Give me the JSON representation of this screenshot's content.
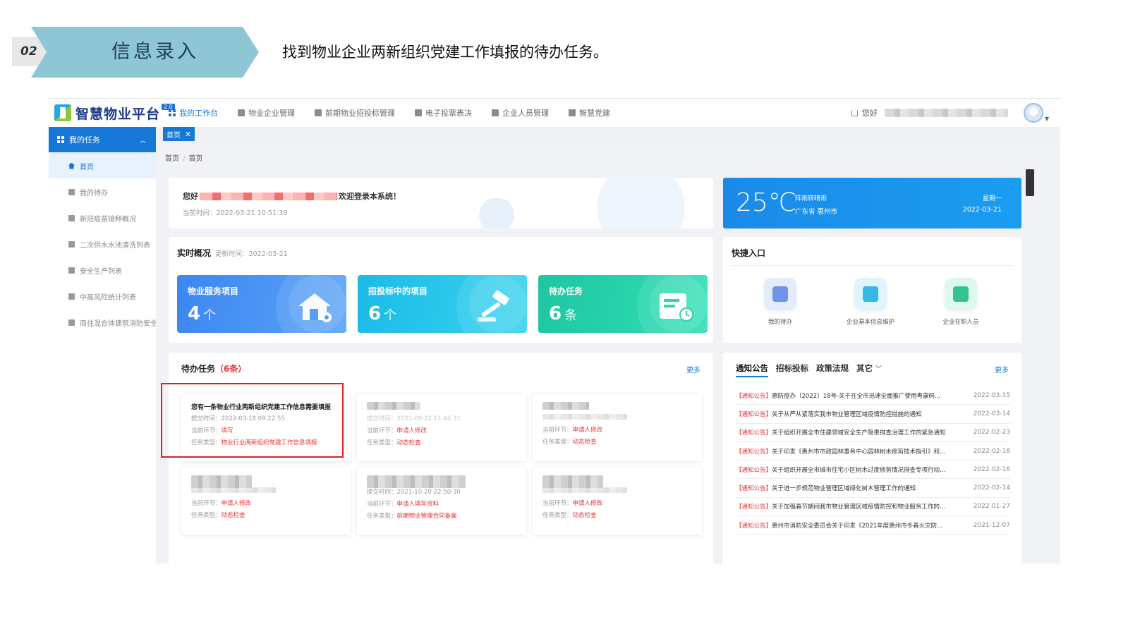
{
  "slide": {
    "step_number": "02",
    "step_title": "信息录入",
    "instruction": "找到物业企业两新组织党建工作填报的待办任务。"
  },
  "colors": {
    "primary": "#1677d8",
    "arrow": "#8fc6d6",
    "highlight": "#e02020",
    "danger": "#e33333"
  },
  "app": {
    "logo_text": "智慧物业平台",
    "logo_version": "2.0",
    "nav": [
      {
        "label": "我的工作台",
        "icon": "grid-icon"
      },
      {
        "label": "物业企业管理",
        "icon": "building-icon"
      },
      {
        "label": "前期物业招投标管理",
        "icon": "document-icon"
      },
      {
        "label": "电子投票表决",
        "icon": "vote-icon"
      },
      {
        "label": "企业人员管理",
        "icon": "person-icon"
      },
      {
        "label": "智慧党建",
        "icon": "flag-icon"
      }
    ],
    "greeting": "您好",
    "sidebar": {
      "group": "我的任务",
      "items": [
        {
          "label": "首页",
          "icon": "home-icon"
        },
        {
          "label": "我的待办",
          "icon": "grid-icon"
        },
        {
          "label": "新冠疫苗接种概况",
          "icon": "edit-icon"
        },
        {
          "label": "二次供水水池清洗列表",
          "icon": "edit-icon"
        },
        {
          "label": "安全生产列表",
          "icon": "briefcase-icon"
        },
        {
          "label": "中高风险统计列表",
          "icon": "table-icon"
        },
        {
          "label": "商住混合体建筑消防安全",
          "icon": "table-icon"
        }
      ]
    },
    "tag": "首页",
    "breadcrumb": [
      "首页",
      "首页"
    ],
    "welcome": {
      "hello": "您好",
      "message": "欢迎登录本系统！",
      "time": "当前时间：2022-03-21 10:51:39"
    },
    "weather": {
      "temp": "25℃",
      "condition": "阵雨转晴雨",
      "city": "广东省 惠州市",
      "weekday": "星期一",
      "date": "2022-03-21"
    },
    "overview": {
      "title": "实时概况",
      "updated": "更新时间：2022-03-21",
      "stats": [
        {
          "label": "物业服务项目",
          "value": "4",
          "unit": "个",
          "icon": "house-icon"
        },
        {
          "label": "招投标中的项目",
          "value": "6",
          "unit": "个",
          "icon": "gavel-icon"
        },
        {
          "label": "待办任务",
          "value": "6",
          "unit": "条",
          "icon": "task-icon"
        }
      ]
    },
    "shortcuts": {
      "title": "快捷入口",
      "items": [
        {
          "label": "我的待办",
          "color": "#e4ecfb",
          "inner": "#6f95e8"
        },
        {
          "label": "企业基本信息维护",
          "color": "#dff4fb",
          "inner": "#37b7e6"
        },
        {
          "label": "企业在职人员",
          "color": "#dff7ee",
          "inner": "#33c38e"
        }
      ]
    },
    "todo": {
      "title": "待办任务",
      "count_open": "（",
      "count": "6条",
      "count_close": "）",
      "more": "更多",
      "tasks": [
        {
          "title": "您有一条物业行业两新组织党建工作信息需要填报",
          "time": "提交时间：2022-03-18 09:22:55",
          "stage_label": "当前环节：",
          "stage": "填写",
          "type_label": "任务类型：",
          "type": "物业行业两新组织党建工作信息填报"
        },
        {
          "title": "",
          "time": "提交时间：2021-09-22 11:44:31",
          "stage_label": "当前环节：",
          "stage": "申请人修改",
          "type_label": "任务类型：",
          "type": "动态检查"
        },
        {
          "title": "",
          "time": "",
          "stage_label": "当前环节：",
          "stage": "申请人修改",
          "type_label": "任务类型：",
          "type": "动态检查"
        },
        {
          "title": "",
          "time": "",
          "stage_label": "当前环节：",
          "stage": "申请人修改",
          "type_label": "任务类型：",
          "type": "动态检查"
        },
        {
          "title": "",
          "time": "提交时间：2021-10-20 22:50:30",
          "stage_label": "当前环节：",
          "stage": "申请人填写资料",
          "type_label": "任务类型：",
          "type": "前期物业管理合同备案"
        },
        {
          "title": "",
          "time": "",
          "stage_label": "当前环节：",
          "stage": "申请人修改",
          "type_label": "任务类型：",
          "type": "动态检查"
        }
      ]
    },
    "notices": {
      "tabs": [
        "通知公告",
        "招标投标",
        "政策法规",
        "其它"
      ],
      "more": "更多",
      "rows": [
        {
          "tag": "【通知公告】",
          "text": "惠防疫办〔2022〕18号-关于在全市迅速全面推广使用粤康码...",
          "date": "2022-03-15"
        },
        {
          "tag": "【通知公告】",
          "text": "关于从严从紧落实我市物业管理区域疫情防控措施的通知",
          "date": "2022-03-14"
        },
        {
          "tag": "【通知公告】",
          "text": "关于组织开展全市住建领域安全生产隐患排查治理工作的紧急通知",
          "date": "2022-02-23"
        },
        {
          "tag": "【通知公告】",
          "text": "关于印发《惠州市市政园林事务中心园林树木修剪技术指引》和《惠...",
          "date": "2022-02-18"
        },
        {
          "tag": "【通知公告】",
          "text": "关于组织开展全市城市住宅小区树木过度修剪情况排查专项行动的通...",
          "date": "2022-02-16"
        },
        {
          "tag": "【通知公告】",
          "text": "关于进一步规范物业管理区域绿化树木管理工作的通知",
          "date": "2022-02-14"
        },
        {
          "tag": "【通知公告】",
          "text": "关于加强春节期间我市物业管理区域疫情防控和物业服务工作的通知...",
          "date": "2022-01-27"
        },
        {
          "tag": "【通知公告】",
          "text": "惠州市消防安全委员会关于印发《2021年度惠州市冬春火灾防控...",
          "date": "2021-12-07"
        }
      ]
    }
  }
}
